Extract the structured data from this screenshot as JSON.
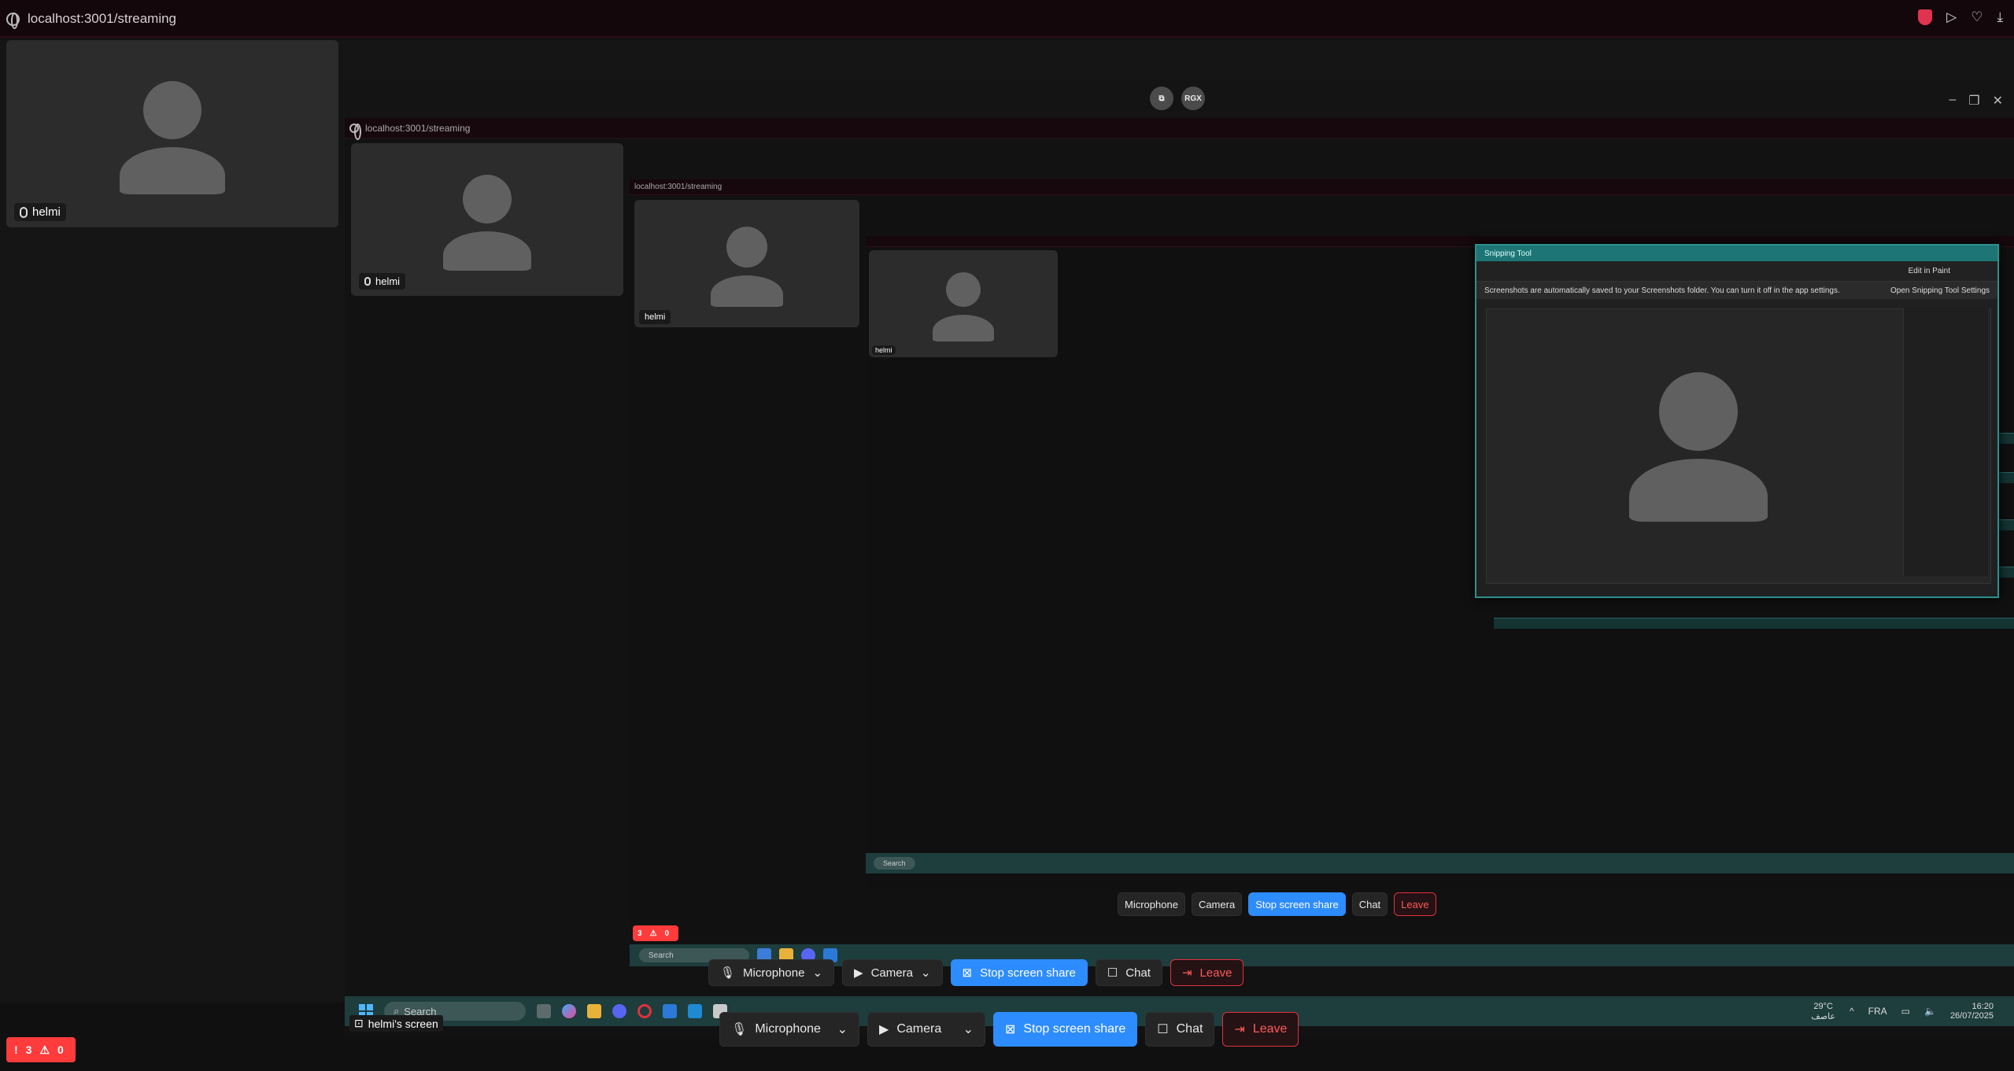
{
  "browser": {
    "url": "localhost:3001/streaming"
  },
  "participant": {
    "name": "helmi",
    "screen_label": "helmi's screen"
  },
  "stage": {
    "rgx_label": "RGX",
    "nested_url": "localhost:3001/streaming"
  },
  "snipping_tool": {
    "title": "Snipping Tool",
    "notice": "Screenshots are automatically saved to your Screenshots folder. You can turn it off in the app settings.",
    "settings_link": "Open Snipping Tool Settings",
    "edit_label": "Edit in Paint"
  },
  "taskbar": {
    "search_placeholder": "Search",
    "weather_temp": "29°C",
    "weather_desc": "عاصف",
    "language": "FRA",
    "time": "16:20",
    "date": "26/07/2025"
  },
  "controls": {
    "microphone": "Microphone",
    "camera": "Camera",
    "stop_share": "Stop screen share",
    "chat": "Chat",
    "leave": "Leave"
  },
  "badge": {
    "count": "3",
    "zero": "0"
  },
  "colors": {
    "primary": "#2d8cff",
    "danger": "#e0323c",
    "taskbar": "#1e3d3d",
    "tile": "#2c2c2c"
  }
}
